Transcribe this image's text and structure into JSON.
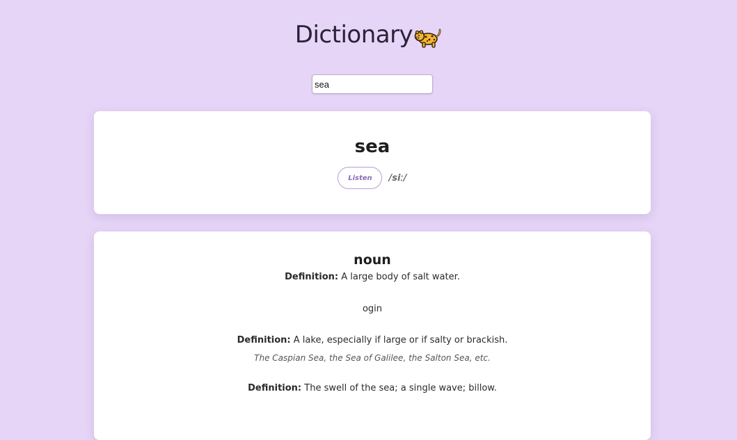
{
  "header": {
    "title": "Dictionary",
    "emoji_icon": "leopard-icon"
  },
  "search": {
    "value": "sea"
  },
  "word_card": {
    "word": "sea",
    "listen_label": "Listen",
    "phonetic": "/siː/"
  },
  "meanings": [
    {
      "part_of_speech": "noun",
      "items": [
        {
          "type": "definition",
          "label": "Definition:",
          "text": "A large body of salt water."
        },
        {
          "type": "plain",
          "text": "ogin"
        },
        {
          "type": "definition",
          "label": "Definition:",
          "text": "A lake, especially if large or if salty or brackish."
        },
        {
          "type": "example",
          "text": "The Caspian Sea, the Sea of Galilee, the Salton Sea, etc."
        },
        {
          "type": "definition",
          "label": "Definition:",
          "text": "The swell of the sea; a single wave; billow."
        }
      ]
    }
  ],
  "colors": {
    "background": "#e6d5f7",
    "accent": "#8a6bb8",
    "card": "#ffffff"
  }
}
